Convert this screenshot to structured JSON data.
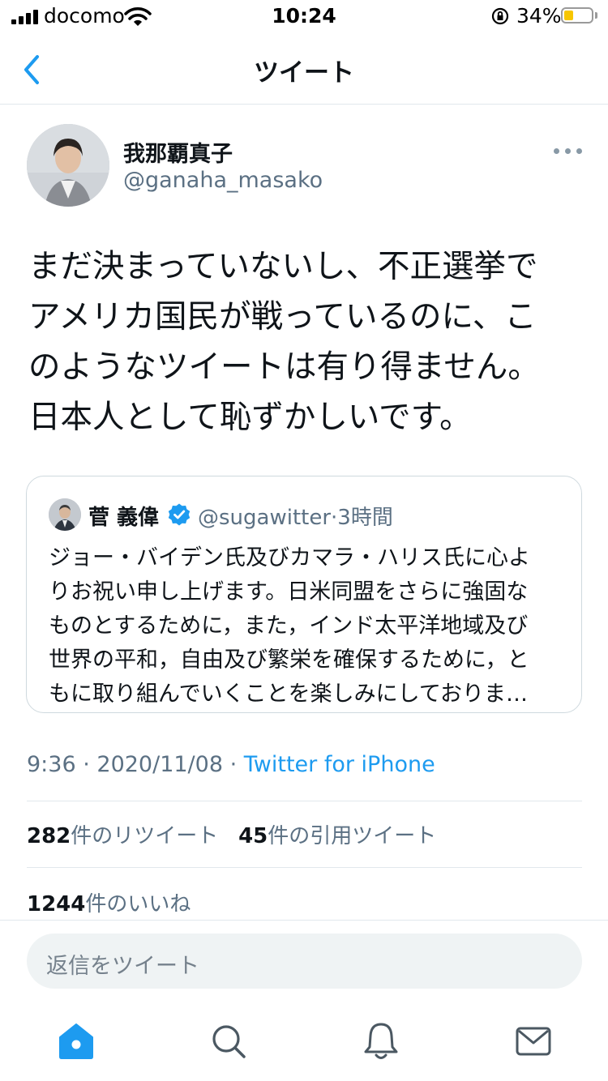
{
  "status_bar": {
    "carrier": "docomo",
    "time": "10:24",
    "battery_percent": "34%",
    "battery_level": 0.34,
    "battery_color": "#f7c600"
  },
  "nav": {
    "title": "ツイート",
    "back_icon": "chevron-left-icon",
    "accent_color": "#1d9bf0"
  },
  "tweet": {
    "author_name": "我那覇真子",
    "author_handle": "@ganaha_masako",
    "text_lines": [
      "まだ決まっていないし、不正選挙で",
      "アメリカ国民が戦っているのに、こ",
      "のようなツイートは有り得ません。",
      "日本人として恥ずかしいです。"
    ],
    "quoted": {
      "name": "菅 義偉",
      "verified_icon": "verified-badge-icon",
      "handle": "@sugawitter",
      "age": "3時間",
      "text_lines": [
        "ジョー・バイデン氏及びカマラ・ハリス氏に心よ",
        "りお祝い申し上げます。日米同盟をさらに強固な",
        "ものとするために，また，インド太平洋地域及び",
        "世界の平和，自由及び繁栄を確保するために，と",
        "もに取り組んでいくことを楽しみにしておりま…"
      ]
    },
    "time": "9:36",
    "date": "2020/11/08",
    "source": "Twitter for iPhone",
    "retweets_count": "282",
    "retweets_label": "件のリツイート",
    "quotes_count": "45",
    "quotes_label": "件の引用ツイート",
    "likes_count": "1244",
    "likes_label": "件のいいね"
  },
  "reply": {
    "placeholder": "返信をツイート"
  },
  "tab_bar": {
    "items": [
      "home-icon",
      "search-icon",
      "notifications-icon",
      "messages-icon"
    ],
    "active": "home-icon"
  }
}
